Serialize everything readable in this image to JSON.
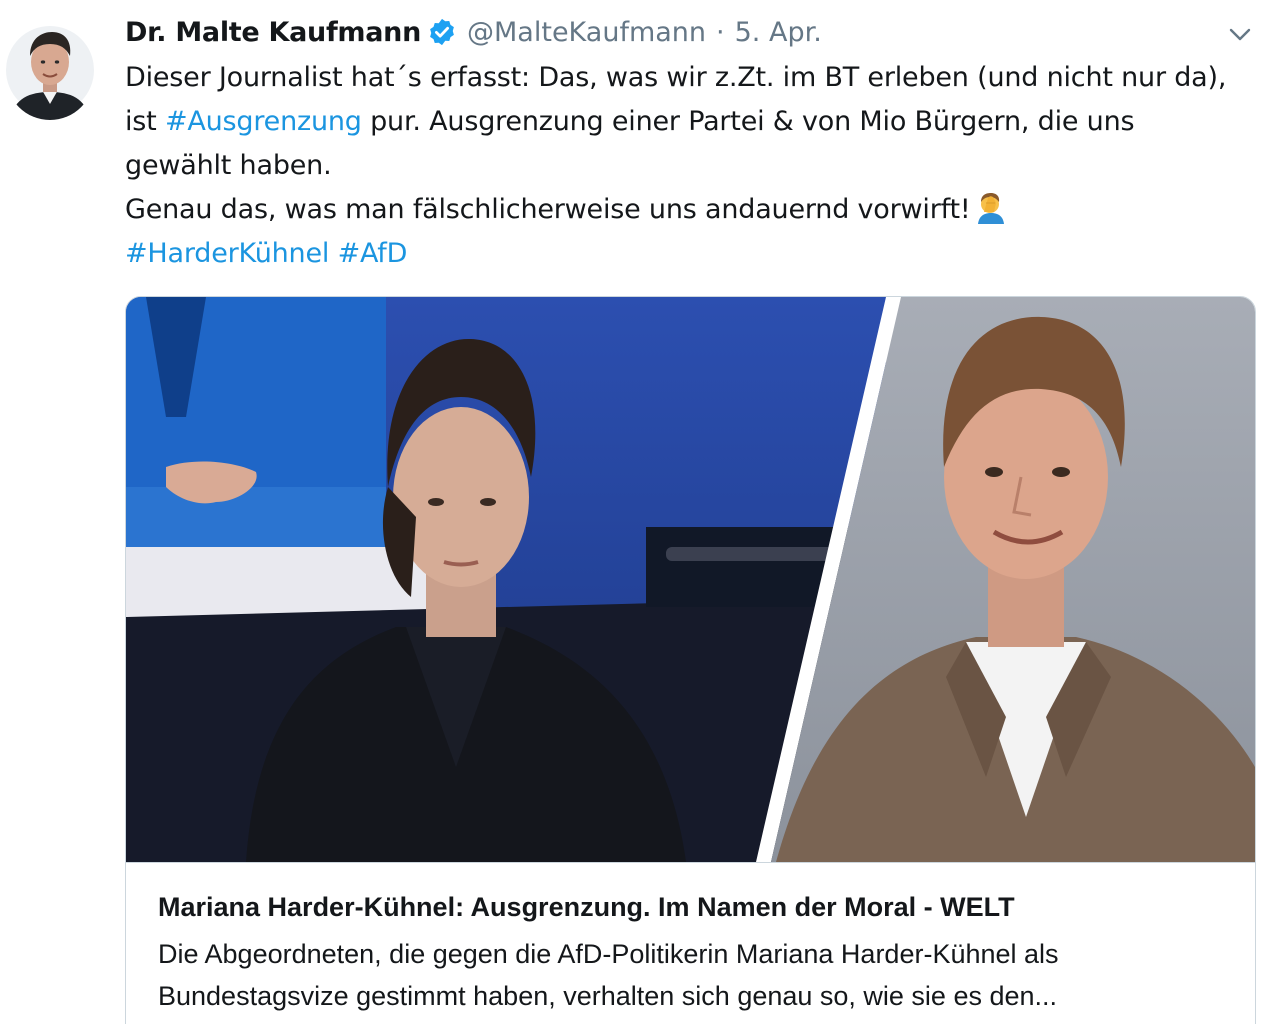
{
  "author": {
    "display_name": "Dr. Malte Kaufmann",
    "handle": "@MalteKaufmann",
    "separator": "·",
    "date": "5. Apr.",
    "avatar_icon": "avatar-photo",
    "verified_icon": "verified-badge-icon",
    "verified_color": "#1da1f2"
  },
  "menu": {
    "caret_icon": "chevron-down-icon"
  },
  "tweet": {
    "line1": "Dieser Journalist hat´s erfasst: Das, was wir z.Zt. im BT erleben (und nicht nur da),",
    "line2_pre": "ist ",
    "line2_hashtag": "#Ausgrenzung",
    "line2_post": " pur. Ausgrenzung einer Partei & von Mio Bürgern, die uns",
    "line3": "gewählt haben.",
    "line4": "Genau das, was man fälschlicherweise uns andauernd vorwirft!",
    "line4_emoji": "facepalm-emoji",
    "hashtag1": "#HarderKühnel",
    "hashtag2": "#AfD",
    "link_color": "#1b95e0"
  },
  "card": {
    "image_icon": "article-photo",
    "title": "Mariana Harder-Kühnel: Ausgrenzung. Im Namen der Moral - WELT",
    "desc_line1": "Die Abgeordneten, die gegen die AfD-Politikerin Mariana Harder-Kühnel als",
    "desc_line2": "Bundestagsvize gestimmt haben, verhalten sich genau so, wie sie es den..."
  }
}
